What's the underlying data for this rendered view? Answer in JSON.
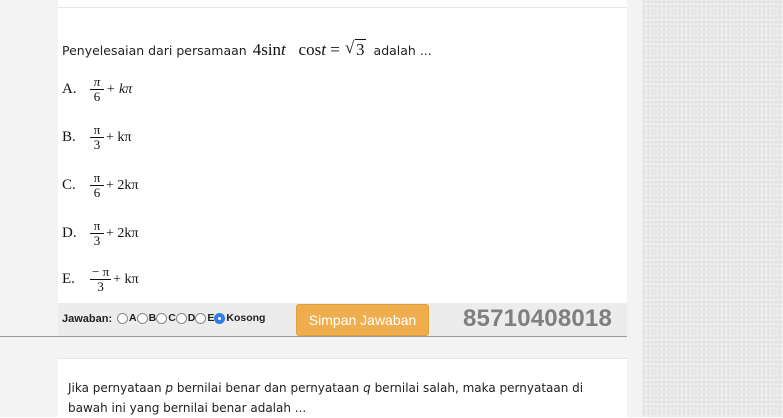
{
  "question1": {
    "text_before": "Penyelesaian dari persamaan",
    "equation": {
      "coef": "4",
      "fn1": "sin",
      "var1": "t",
      "fn2": "cos",
      "var2": "t",
      "equals": "=",
      "sqrt_arg": "3"
    },
    "text_after": "adalah ...",
    "options": [
      {
        "letter": "A.",
        "num": "π",
        "den": "6",
        "rest": "+ kπ"
      },
      {
        "letter": "B.",
        "num": "π",
        "den": "3",
        "rest": "+ kπ"
      },
      {
        "letter": "C.",
        "num": "π",
        "den": "6",
        "rest": "+ 2kπ"
      },
      {
        "letter": "D.",
        "num": "π",
        "den": "3",
        "rest": "+ 2kπ"
      },
      {
        "letter": "E.",
        "num": "− π",
        "den": "3",
        "rest": "+ kπ"
      }
    ]
  },
  "answer_bar": {
    "label": "Jawaban:",
    "choices": [
      "A",
      "B",
      "C",
      "D",
      "E",
      "Kosong"
    ],
    "selected": "Kosong",
    "save_button": "Simpan Jawaban",
    "code": "85710408018"
  },
  "question2": {
    "part1": "Jika pernyataan",
    "p": "p",
    "part2": "bernilai benar dan pernyataan",
    "q": "q",
    "part3": "bernilai salah, maka pernyataan di bawah ini yang bernilai benar adalah ..."
  },
  "colors": {
    "button": "#f0ad4e",
    "radio_selected": "#2f7ee0",
    "code_text": "#7f7f7f"
  }
}
